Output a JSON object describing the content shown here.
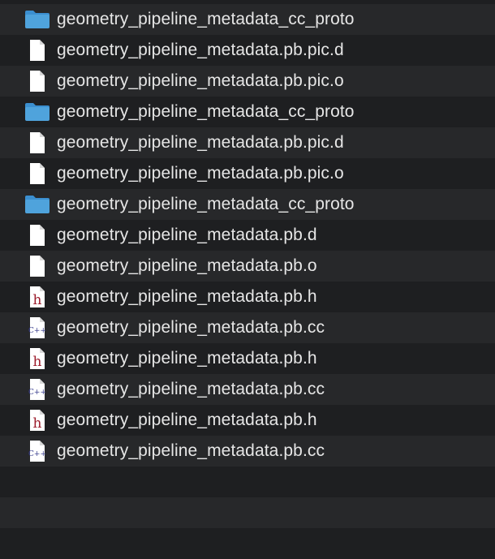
{
  "files": [
    {
      "name": "geometry_pipeline_metadata_cc_proto",
      "icon": "folder-icon"
    },
    {
      "name": "geometry_pipeline_metadata.pb.pic.d",
      "icon": "document-icon"
    },
    {
      "name": "geometry_pipeline_metadata.pb.pic.o",
      "icon": "document-icon"
    },
    {
      "name": "geometry_pipeline_metadata_cc_proto",
      "icon": "folder-icon"
    },
    {
      "name": "geometry_pipeline_metadata.pb.pic.d",
      "icon": "document-icon"
    },
    {
      "name": "geometry_pipeline_metadata.pb.pic.o",
      "icon": "document-icon"
    },
    {
      "name": "geometry_pipeline_metadata_cc_proto",
      "icon": "folder-icon"
    },
    {
      "name": "geometry_pipeline_metadata.pb.d",
      "icon": "document-icon"
    },
    {
      "name": "geometry_pipeline_metadata.pb.o",
      "icon": "document-icon"
    },
    {
      "name": "geometry_pipeline_metadata.pb.h",
      "icon": "header-file-icon"
    },
    {
      "name": "geometry_pipeline_metadata.pb.cc",
      "icon": "cpp-file-icon"
    },
    {
      "name": "geometry_pipeline_metadata.pb.h",
      "icon": "header-file-icon"
    },
    {
      "name": "geometry_pipeline_metadata.pb.cc",
      "icon": "cpp-file-icon"
    },
    {
      "name": "geometry_pipeline_metadata.pb.h",
      "icon": "header-file-icon"
    },
    {
      "name": "geometry_pipeline_metadata.pb.cc",
      "icon": "cpp-file-icon"
    }
  ],
  "icon_labels": {
    "header": "h",
    "cpp": "C++"
  },
  "colors": {
    "background": "#1e1f21",
    "row_alt": "#27282a",
    "text": "#e6e6e6",
    "folder": "#4fa3dc",
    "header_letter": "#9c1c2b",
    "cpp_letter": "#3a3f8f"
  }
}
